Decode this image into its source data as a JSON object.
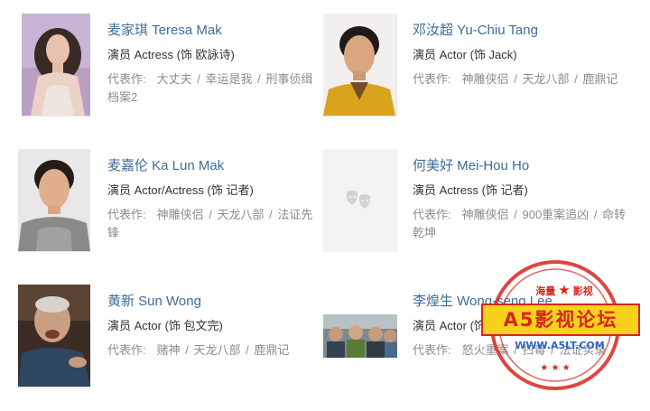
{
  "cast": [
    {
      "name": "麦家琪 Teresa Mak",
      "role": "演员 Actress (饰 欧詠诗)",
      "works_label": "代表作:",
      "works": [
        "大丈夫",
        "幸运是我",
        "刑事侦缉档案2"
      ]
    },
    {
      "name": "邓汝超 Yu-Chiu Tang",
      "role": "演员 Actor (饰 Jack)",
      "works_label": "代表作:",
      "works": [
        "神雕侠侣",
        "天龙八部",
        "鹿鼎记"
      ]
    },
    {
      "name": "麦嘉伦 Ka Lun Mak",
      "role": "演员 Actor/Actress (饰 记者)",
      "works_label": "代表作:",
      "works": [
        "神雕侠侣",
        "天龙八部",
        "法证先锋"
      ]
    },
    {
      "name": "何美好 Mei-Hou Ho",
      "role": "演员 Actress (饰 记者)",
      "works_label": "代表作:",
      "works": [
        "神雕侠侣",
        "900重案追凶",
        "命转乾坤"
      ]
    },
    {
      "name": "黄新 Sun Wong",
      "role": "演员 Actor (饰 包文完)",
      "works_label": "代表作:",
      "works": [
        "赌神",
        "天龙八部",
        "鹿鼎记"
      ]
    },
    {
      "name": "李煌生 Wong-seng Lee",
      "role": "演员 Actor (饰 Joe)",
      "works_label": "代表作:",
      "works": [
        "怒火重案",
        "扫毒",
        "法证实录"
      ]
    }
  ],
  "watermark": {
    "top_left": "海量",
    "top_right": "影视",
    "title": "A5影视论坛",
    "url": "WWW.A5LT.COM"
  },
  "colors": {
    "link": "#3f6d98",
    "text": "#333333",
    "muted": "#8c8c8c",
    "stamp_red": "#d7261e",
    "stamp_yellow": "#f7d21a"
  }
}
